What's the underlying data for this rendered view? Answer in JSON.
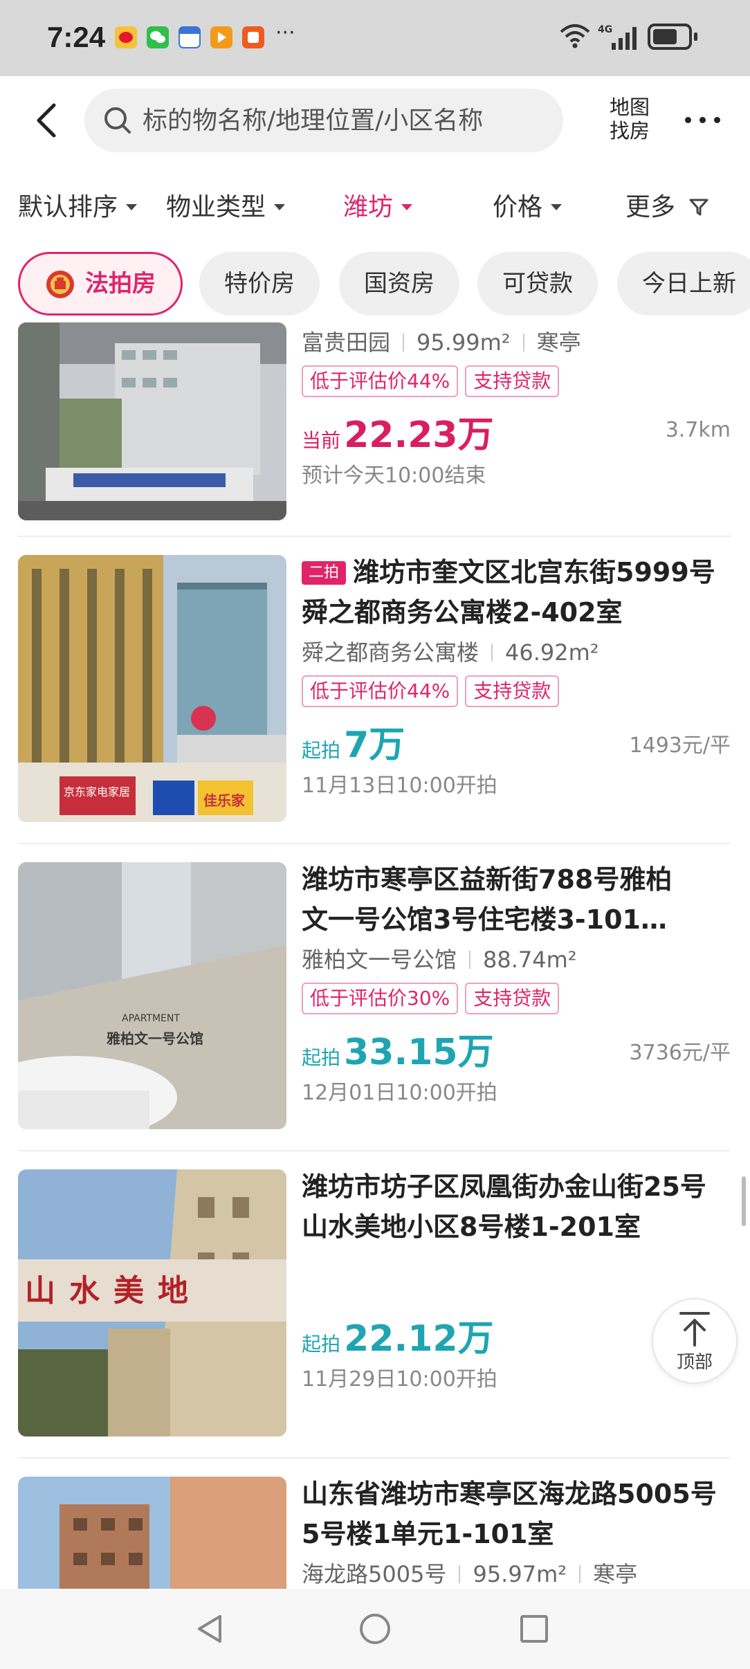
{
  "status_bar": {
    "time": "7:24",
    "network": "4G",
    "battery_level": 0.7,
    "app_icons": [
      "weibo-icon",
      "wechat-icon",
      "calendar-icon",
      "video-app-icon",
      "shopping-app-icon"
    ]
  },
  "header": {
    "search_placeholder": "标的物名称/地理位置/小区名称",
    "map_label_line1": "地图",
    "map_label_line2": "找房"
  },
  "filters": [
    {
      "label": "默认排序",
      "active": false
    },
    {
      "label": "物业类型",
      "active": false
    },
    {
      "label": "潍坊",
      "active": true
    },
    {
      "label": "价格",
      "active": false
    },
    {
      "label": "更多",
      "active": false
    }
  ],
  "chips": [
    {
      "label": "法拍房",
      "active": true
    },
    {
      "label": "特价房",
      "active": false
    },
    {
      "label": "国资房",
      "active": false
    },
    {
      "label": "可贷款",
      "active": false
    },
    {
      "label": "今日上新",
      "active": false
    }
  ],
  "listings": [
    {
      "title": "",
      "community": "富贵田园",
      "area": "95.99m²",
      "district": "寒亭",
      "tags": [
        "低于评估价44%",
        "支持贷款"
      ],
      "price_label": "当前",
      "price": "22.23万",
      "aux": "3.7km",
      "sub": "预计今天10:00结束"
    },
    {
      "badge": "二拍",
      "title": "潍坊市奎文区北宫东街5999号舜之都商务公寓楼2-402室",
      "community": "舜之都商务公寓楼",
      "area": "46.92m²",
      "tags": [
        "低于评估价44%",
        "支持贷款"
      ],
      "price_label": "起拍",
      "price": "7万",
      "aux": "1493元/平",
      "sub": "11月13日10:00开拍",
      "image_text": [
        "京东家电家居",
        "佳乐家"
      ]
    },
    {
      "title_line1": "潍坊市寒亭区益新街788号雅柏",
      "title_line2": "文一号公馆3号住宅楼3-101…",
      "community": "雅柏文一号公馆",
      "area": "88.74m²",
      "tags": [
        "低于评估价30%",
        "支持贷款"
      ],
      "price_label": "起拍",
      "price": "33.15万",
      "aux": "3736元/平",
      "sub": "12月01日10:00开拍",
      "image_text": [
        "APARTMENT",
        "雅柏文一号公馆"
      ]
    },
    {
      "title": "潍坊市坊子区凤凰街办金山街25号山水美地小区8号楼1-201室",
      "price_label": "起拍",
      "price": "22.12万",
      "sub": "11月29日10:00开拍",
      "image_text": "山水美地"
    },
    {
      "title": "山东省潍坊市寒亭区海龙路5005号5号楼1单元1-101室",
      "community": "海龙路5005号",
      "area": "95.97m²",
      "district": "寒亭"
    }
  ],
  "top_button": {
    "label": "顶部"
  },
  "colors": {
    "accent": "#e0246a",
    "teal": "#1fa5b2",
    "price_pink": "#d81f60"
  }
}
